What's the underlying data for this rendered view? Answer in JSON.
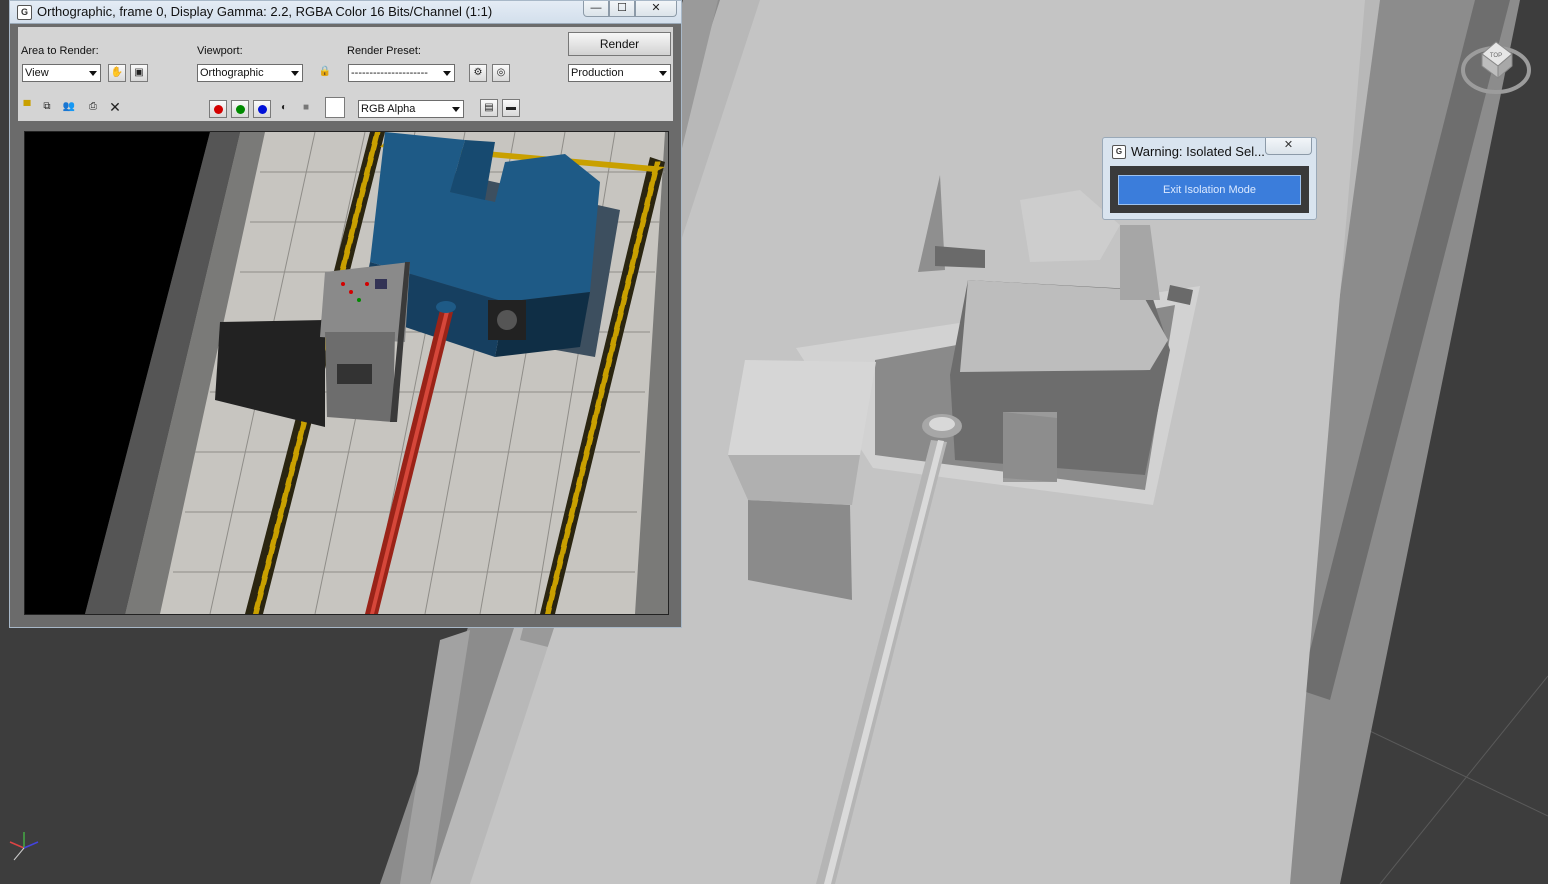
{
  "frame_window": {
    "title": "Orthographic, frame 0, Display Gamma: 2.2, RGBA Color 16 Bits/Channel (1:1)",
    "controls": {
      "minimize": "—",
      "maximize": "☐",
      "close": "✕"
    },
    "area_to_render": {
      "label": "Area to Render:",
      "value": "View"
    },
    "viewport": {
      "label": "Viewport:",
      "value": "Orthographic"
    },
    "render_preset": {
      "label": "Render Preset:",
      "value": "---------------------"
    },
    "render_button": "Render",
    "render_mode": "Production",
    "channel_display": "RGB Alpha",
    "colors": {
      "red": "#d40000",
      "green": "#008a00",
      "blue": "#0010d8"
    }
  },
  "warning_dialog": {
    "title": "Warning: Isolated Sel...",
    "close": "✕",
    "button": "Exit Isolation Mode"
  },
  "view_cube": {
    "face": "TOP"
  }
}
